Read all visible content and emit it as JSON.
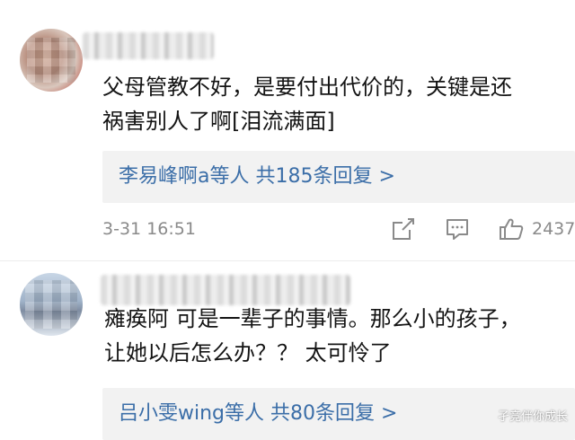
{
  "comments": [
    {
      "text_line1": "父母管教不好，是要付出代价的，关键是还",
      "text_line2": "祸害别人了啊[泪流满面]",
      "reply_summary": "李易峰啊a等人 共185条回复 >",
      "timestamp": "3-31 16:51",
      "like_count": "2437",
      "icons": [
        "share-icon",
        "comment-icon",
        "like-icon"
      ]
    },
    {
      "text_line1": "瘫痪阿 可是一辈子的事情。那么小的孩子，",
      "text_line2": "让她以后怎么办？？ 太可怜了",
      "reply_summary": "吕小雯wing等人 共80条回复 >"
    }
  ],
  "watermark": "孑竞伴你成长",
  "colors": {
    "link": "#3b6ea8",
    "reply_bg": "#f2f2f2",
    "meta": "#8a8a8a"
  }
}
